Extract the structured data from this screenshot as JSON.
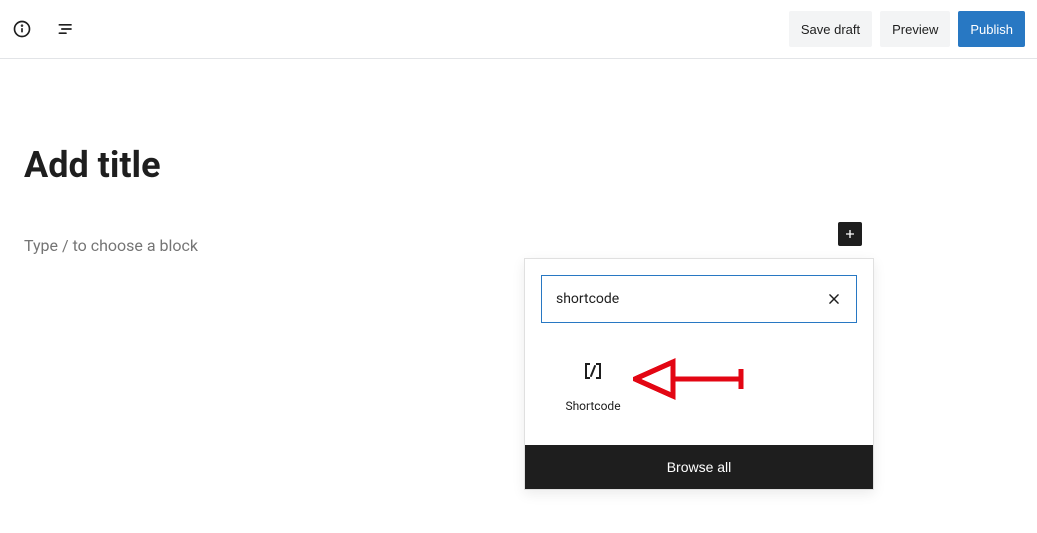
{
  "toolbar": {
    "save_draft": "Save draft",
    "preview": "Preview",
    "publish": "Publish"
  },
  "editor": {
    "title_placeholder": "Add title",
    "body_placeholder": "Type / to choose a block"
  },
  "inserter": {
    "search_value": "shortcode",
    "result_label": "Shortcode",
    "browse_all": "Browse all"
  }
}
